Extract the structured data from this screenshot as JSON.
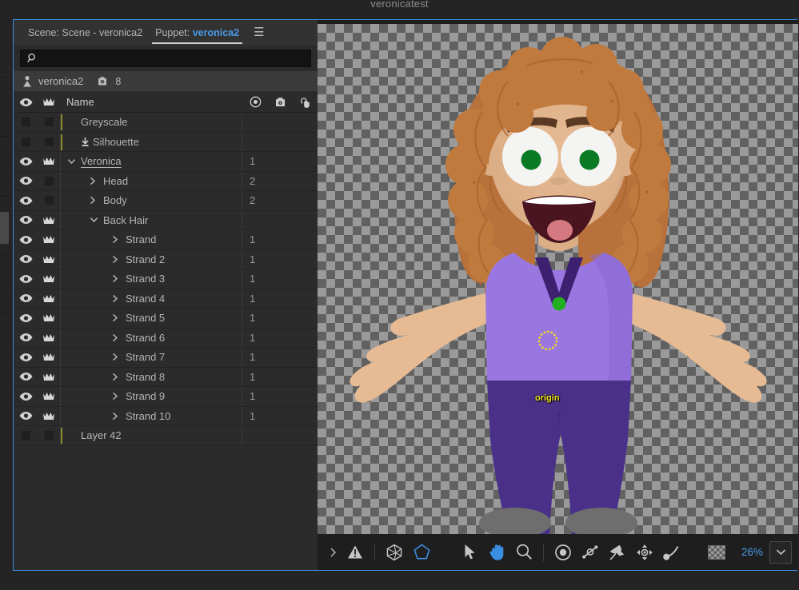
{
  "window": {
    "title": "veronicatest"
  },
  "tabs": [
    {
      "label": "Scene: Scene - veronica2",
      "prefix": "Scene: ",
      "value": "Scene - veronica2",
      "active": false
    },
    {
      "label": "Puppet: veronica2",
      "prefix": "Puppet: ",
      "value": "veronica2",
      "active": true
    }
  ],
  "panel_menu_icon": "hamburger-menu-icon",
  "search": {
    "value": "",
    "placeholder": "",
    "icon": "search-icon"
  },
  "puppet_info": {
    "icon": "puppet-icon",
    "name": "veronica2",
    "behaviors_icon": "behaviors-icon",
    "behaviors_count": "8"
  },
  "list_header": {
    "eye_icon": "eye-icon",
    "crown_icon": "crown-icon",
    "name": "Name",
    "origin_icon": "origin-icon",
    "behaviors_icon": "behaviors-icon",
    "handle_icon": "draggable-hand-icon"
  },
  "layers": [
    {
      "name": "Greyscale",
      "indent": 1,
      "twisty": "",
      "visible": false,
      "crown": false,
      "count": "",
      "ymark": true,
      "arrow_icon": ""
    },
    {
      "name": "Silhouette",
      "indent": 1,
      "twisty": "",
      "visible": false,
      "crown": false,
      "count": "",
      "ymark": true,
      "arrow_icon": "down-arrow-to-bar-icon"
    },
    {
      "name": "Veronica",
      "indent": 1,
      "twisty": "v",
      "visible": true,
      "crown": true,
      "count": "1",
      "ymark": false,
      "underline": true,
      "arrow_icon": ""
    },
    {
      "name": "Head",
      "indent": 2,
      "twisty": ">",
      "visible": true,
      "crown": false,
      "count": "2",
      "ymark": false,
      "arrow_icon": ""
    },
    {
      "name": "Body",
      "indent": 2,
      "twisty": ">",
      "visible": true,
      "crown": false,
      "count": "2",
      "ymark": false,
      "arrow_icon": ""
    },
    {
      "name": "Back Hair",
      "indent": 2,
      "twisty": "v",
      "visible": true,
      "crown": true,
      "count": "",
      "ymark": false,
      "arrow_icon": ""
    },
    {
      "name": "Strand",
      "indent": 3,
      "twisty": ">",
      "visible": true,
      "crown": true,
      "count": "1",
      "ymark": false,
      "arrow_icon": ""
    },
    {
      "name": "Strand 2",
      "indent": 3,
      "twisty": ">",
      "visible": true,
      "crown": true,
      "count": "1",
      "ymark": false,
      "arrow_icon": ""
    },
    {
      "name": "Strand 3",
      "indent": 3,
      "twisty": ">",
      "visible": true,
      "crown": true,
      "count": "1",
      "ymark": false,
      "arrow_icon": ""
    },
    {
      "name": "Strand 4",
      "indent": 3,
      "twisty": ">",
      "visible": true,
      "crown": true,
      "count": "1",
      "ymark": false,
      "arrow_icon": ""
    },
    {
      "name": "Strand 5",
      "indent": 3,
      "twisty": ">",
      "visible": true,
      "crown": true,
      "count": "1",
      "ymark": false,
      "arrow_icon": ""
    },
    {
      "name": "Strand 6",
      "indent": 3,
      "twisty": ">",
      "visible": true,
      "crown": true,
      "count": "1",
      "ymark": false,
      "arrow_icon": ""
    },
    {
      "name": "Strand 7",
      "indent": 3,
      "twisty": ">",
      "visible": true,
      "crown": true,
      "count": "1",
      "ymark": false,
      "arrow_icon": ""
    },
    {
      "name": "Strand 8",
      "indent": 3,
      "twisty": ">",
      "visible": true,
      "crown": true,
      "count": "1",
      "ymark": false,
      "arrow_icon": ""
    },
    {
      "name": "Strand 9",
      "indent": 3,
      "twisty": ">",
      "visible": true,
      "crown": true,
      "count": "1",
      "ymark": false,
      "arrow_icon": ""
    },
    {
      "name": "Strand 10",
      "indent": 3,
      "twisty": ">",
      "visible": true,
      "crown": true,
      "count": "1",
      "ymark": false,
      "arrow_icon": ""
    },
    {
      "name": "Layer 42",
      "indent": 1,
      "twisty": "",
      "visible": false,
      "crown": false,
      "count": "",
      "ymark": true,
      "arrow_icon": ""
    }
  ],
  "canvas": {
    "origin_label": "origin",
    "origin_color": "#f2e21a",
    "checker_light": "#9a9a9a",
    "checker_dark": "#616161",
    "character": {
      "hair_color": "#c07a3e",
      "hair_dark": "#a8642f",
      "skin_color": "#e6bb94",
      "skin_shadow": "#d3a882",
      "eye_white": "#f4f4f2",
      "iris_color": "#0b7a25",
      "brow_color": "#5a3a22",
      "mouth_outer": "#4a1520",
      "mouth_tongue": "#d4797f",
      "shirt_color": "#9a77e0",
      "shirt_shadow": "#8a68cf",
      "logo_color": "#3d2070",
      "logo_dot": "#22b022",
      "pants_color": "#4a3089",
      "shoe_color": "#6e6e6e"
    }
  },
  "toolbar": {
    "left": [
      {
        "icon": "chevron-right-icon",
        "name": "expand-toolbar-chevron",
        "active": false
      },
      {
        "icon": "warning-triangle-icon",
        "name": "warnings-button",
        "active": false
      },
      {
        "icon": "mesh-polygon-icon",
        "name": "show-mesh-button",
        "active": false
      },
      {
        "icon": "pentagon-outline-icon",
        "name": "show-outline-button",
        "active": true
      }
    ],
    "tools": [
      {
        "icon": "arrow-cursor-icon",
        "name": "selection-tool",
        "active": false
      },
      {
        "icon": "hand-icon",
        "name": "hand-tool",
        "active": true
      },
      {
        "icon": "magnifier-icon",
        "name": "zoom-tool",
        "active": false
      }
    ],
    "pins": [
      {
        "icon": "origin-target-icon",
        "name": "origin-tool",
        "active": false
      },
      {
        "icon": "dangle-handle-icon",
        "name": "dangle-tool",
        "active": false
      },
      {
        "icon": "pushpin-icon",
        "name": "stick-tool",
        "active": false
      },
      {
        "icon": "move-crosshair-icon",
        "name": "draggable-tool",
        "active": false
      },
      {
        "icon": "dragger-curve-icon",
        "name": "dragger-tool",
        "active": false
      }
    ],
    "transparency": {
      "icon": "checkerboard-icon",
      "name": "transparency-grid-toggle",
      "active": false
    },
    "zoom": {
      "value": "26%",
      "dropdown_icon": "chevron-down-icon"
    }
  }
}
